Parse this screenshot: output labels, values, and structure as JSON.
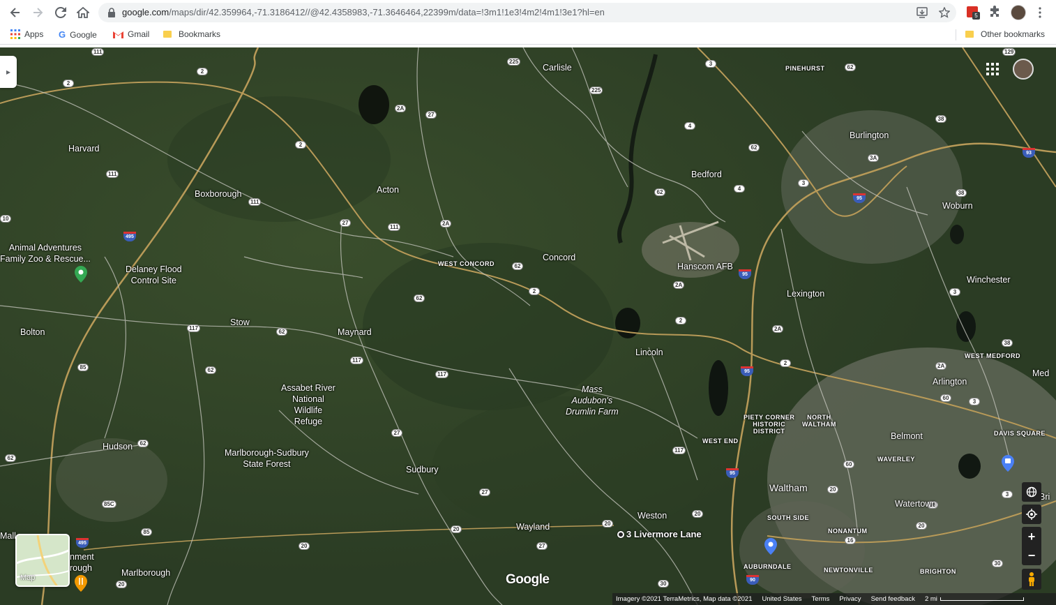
{
  "browser": {
    "url_host": "google.com",
    "url_path": "/maps/dir/42.359964,-71.3186412//@42.4358983,-71.3646464,22399m/data=!3m1!1e3!4m2!4m1!3e1?hl=en",
    "extension_badge": "5"
  },
  "bookmarks": {
    "apps": "Apps",
    "google": "Google",
    "gmail": "Gmail",
    "bookmarks": "Bookmarks",
    "other": "Other bookmarks"
  },
  "map": {
    "places": {
      "harvard": "Harvard",
      "boxborough": "Boxborough",
      "acton": "Acton",
      "carlisle": "Carlisle",
      "pinehurst": "PINEHURST",
      "burlington": "Burlington",
      "bedford": "Bedford",
      "woburn": "Woburn",
      "animal_adventures": "Animal Adventures\nFamily Zoo & Rescue...",
      "delaney": "Delaney Flood\nControl Site",
      "west_concord": "WEST CONCORD",
      "concord": "Concord",
      "hanscom": "Hanscom AFB",
      "lexington": "Lexington",
      "winchester": "Winchester",
      "bolton": "Bolton",
      "stow": "Stow",
      "maynard": "Maynard",
      "lincoln": "Lincoln",
      "west_medford": "WEST MEDFORD",
      "arlington": "Arlington",
      "assabet": "Assabet River\nNational\nWildlife\nRefuge",
      "mass_audubon": "Mass\nAudubon's\nDrumlin Farm",
      "piety_corner": "PIETY CORNER\nHISTORIC\nDISTRICT",
      "north_waltham": "NORTH\nWALTHAM",
      "med": "Med",
      "hudson": "Hudson",
      "marlborough_sudbury": "Marlborough-Sudbury\nState Forest",
      "west_end": "WEST END",
      "belmont": "Belmont",
      "davis_square": "DAVIS SQUARE",
      "sudbury": "Sudbury",
      "waverley": "WAVERLEY",
      "waltham": "Waltham",
      "watertown": "Watertown",
      "bri": "Bri",
      "south_side": "SOUTH SIDE",
      "weston": "Weston",
      "wayland": "Wayland",
      "nonantum": "NONANTUM",
      "auburndale": "AUBURNDALE",
      "newtonville": "NEWTONVILLE",
      "brighton": "BRIGHTON",
      "marlborough": "Marlborough",
      "mall": "Mall",
      "nment": "nment",
      "rough": "rough"
    },
    "destination": "3 Livermore Lane",
    "layers_label": "Map",
    "logo": "Google",
    "footer": {
      "imagery": "Imagery ©2021 TerraMetrics, Map data ©2021",
      "country": "United States",
      "terms": "Terms",
      "privacy": "Privacy",
      "feedback": "Send feedback",
      "scale": "2 mi"
    }
  }
}
